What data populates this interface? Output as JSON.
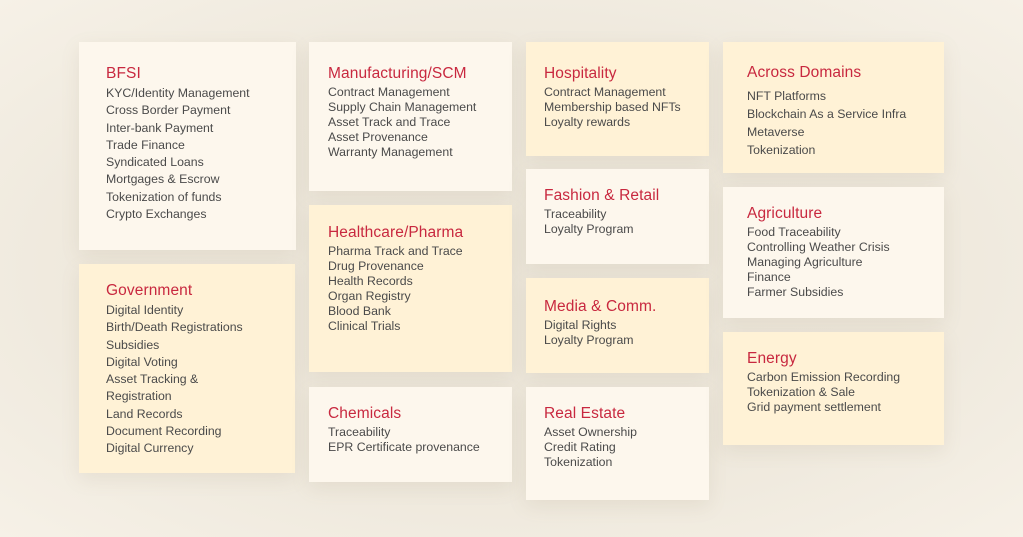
{
  "colors": {
    "title": "#c8283f",
    "text": "#4a4a4a",
    "card_light": "#fdf7ed",
    "card_yellow": "#fff2d6",
    "background": "#eee8dc"
  },
  "cards": [
    {
      "title": "BFSI",
      "items": [
        "KYC/Identity Management",
        "Cross Border Payment",
        "Inter-bank Payment",
        "Trade Finance",
        "Syndicated Loans",
        "Mortgages & Escrow",
        "Tokenization of funds",
        "Crypto Exchanges"
      ]
    },
    {
      "title": "Government",
      "items": [
        "Digital Identity",
        "Birth/Death Registrations",
        "Subsidies",
        "Digital Voting",
        "Asset Tracking &",
        "Registration",
        "Land Records",
        "Document Recording",
        "Digital Currency"
      ]
    },
    {
      "title": "Manufacturing/SCM",
      "items": [
        "Contract Management",
        "Supply Chain Management",
        "Asset Track and Trace",
        "Asset Provenance",
        "Warranty Management"
      ]
    },
    {
      "title": "Healthcare/Pharma",
      "items": [
        "Pharma Track and Trace",
        "Drug Provenance",
        "Health Records",
        "Organ Registry",
        "Blood Bank",
        "Clinical Trials"
      ]
    },
    {
      "title": "Chemicals",
      "items": [
        "Traceability",
        "EPR Certificate provenance"
      ]
    },
    {
      "title": "Hospitality",
      "items": [
        "Contract Management",
        "Membership based NFTs",
        "Loyalty rewards"
      ]
    },
    {
      "title": "Fashion & Retail",
      "items": [
        "Traceability",
        "Loyalty Program"
      ]
    },
    {
      "title": "Media & Comm.",
      "items": [
        "Digital Rights",
        "Loyalty Program"
      ]
    },
    {
      "title": "Real Estate",
      "items": [
        "Asset Ownership",
        "Credit Rating",
        "Tokenization"
      ]
    },
    {
      "title": "Across Domains",
      "items": [
        "NFT Platforms",
        "Blockchain As a Service Infra",
        "Metaverse",
        "Tokenization"
      ]
    },
    {
      "title": "Agriculture",
      "items": [
        "Food Traceability",
        "Controlling Weather Crisis",
        "Managing Agriculture",
        "Finance",
        "Farmer Subsidies"
      ]
    },
    {
      "title": "Energy",
      "items": [
        "Carbon Emission Recording",
        "Tokenization & Sale",
        "Grid payment settlement"
      ]
    }
  ]
}
